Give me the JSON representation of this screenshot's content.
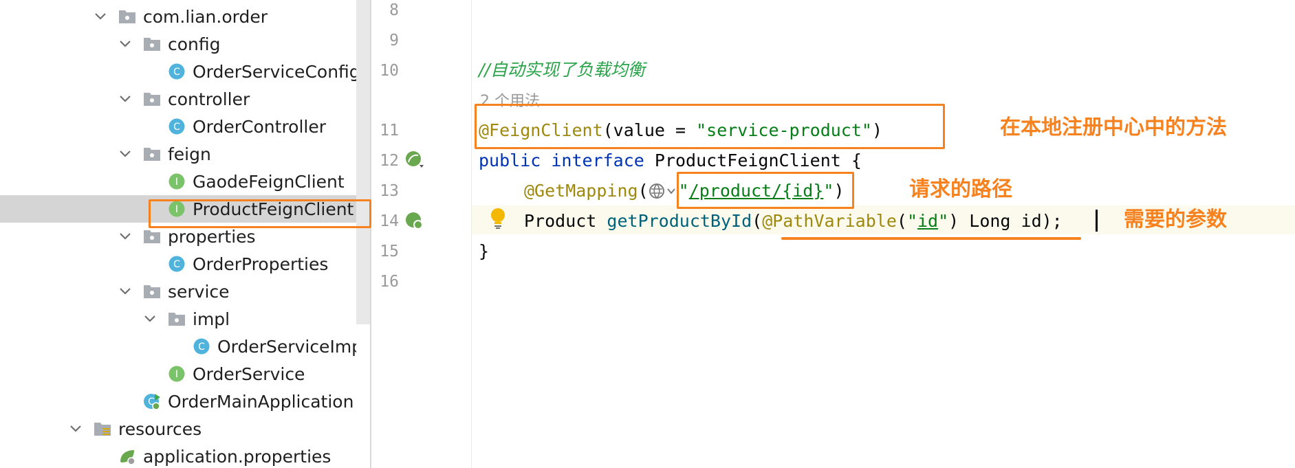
{
  "tree": {
    "items": [
      {
        "label": "com.lian.order",
        "icon": "package-folder-icon",
        "chev": true
      },
      {
        "label": "config",
        "icon": "package-folder-icon",
        "chev": true
      },
      {
        "label": "OrderServiceConfig",
        "icon": "class-icon",
        "letter": "C"
      },
      {
        "label": "controller",
        "icon": "package-folder-icon",
        "chev": true
      },
      {
        "label": "OrderController",
        "icon": "class-icon",
        "letter": "C"
      },
      {
        "label": "feign",
        "icon": "package-folder-icon",
        "chev": true
      },
      {
        "label": "GaodeFeignClient",
        "icon": "interface-icon",
        "letter": "I"
      },
      {
        "label": "ProductFeignClient",
        "icon": "interface-icon",
        "letter": "I"
      },
      {
        "label": "properties",
        "icon": "package-folder-icon",
        "chev": true
      },
      {
        "label": "OrderProperties",
        "icon": "class-icon",
        "letter": "C"
      },
      {
        "label": "service",
        "icon": "package-folder-icon",
        "chev": true
      },
      {
        "label": "impl",
        "icon": "package-folder-icon",
        "chev": true
      },
      {
        "label": "OrderServiceImpl",
        "icon": "class-icon",
        "letter": "C"
      },
      {
        "label": "OrderService",
        "icon": "interface-icon",
        "letter": "I"
      },
      {
        "label": "OrderMainApplication",
        "icon": "spring-boot-app-icon",
        "letter": "C"
      },
      {
        "label": "resources",
        "icon": "resources-folder-icon",
        "chev": true
      },
      {
        "label": "application.properties",
        "icon": "spring-properties-icon"
      }
    ],
    "selected": "ProductFeignClient"
  },
  "gutter": {
    "lines": [
      "8",
      "9",
      "10",
      "11",
      "12",
      "13",
      "14",
      "15",
      "16"
    ]
  },
  "editor": {
    "comment": "//自动实现了负载均衡",
    "usages": "2 个用法",
    "line11": {
      "annotation": "@FeignClient",
      "open": "(value = ",
      "value": "\"service-product\"",
      "close": ")"
    },
    "line12": {
      "kw1": "public",
      "kw2": "interface",
      "name": "ProductFeignClient",
      "brace": "{"
    },
    "line13": {
      "annotation": "@GetMapping",
      "open": "(",
      "q1": "\"",
      "path": "/product/{id}",
      "q2": "\"",
      "close": ")"
    },
    "line14": {
      "type": "Product",
      "method": "getProductById",
      "open": "(",
      "annotation": "@PathVariable",
      "p_open": "(",
      "q1": "\"",
      "name": "id",
      "q2": "\"",
      "rest": ") Long id);"
    },
    "line15": "}"
  },
  "notes": {
    "registry": "在本地注册中心中的方法",
    "path": "请求的路径",
    "params": "需要的参数"
  },
  "colors": {
    "accent": "#f6811f",
    "keyword": "#0033b3",
    "annotation": "#9e880d",
    "string": "#067d17",
    "method": "#00627a"
  }
}
